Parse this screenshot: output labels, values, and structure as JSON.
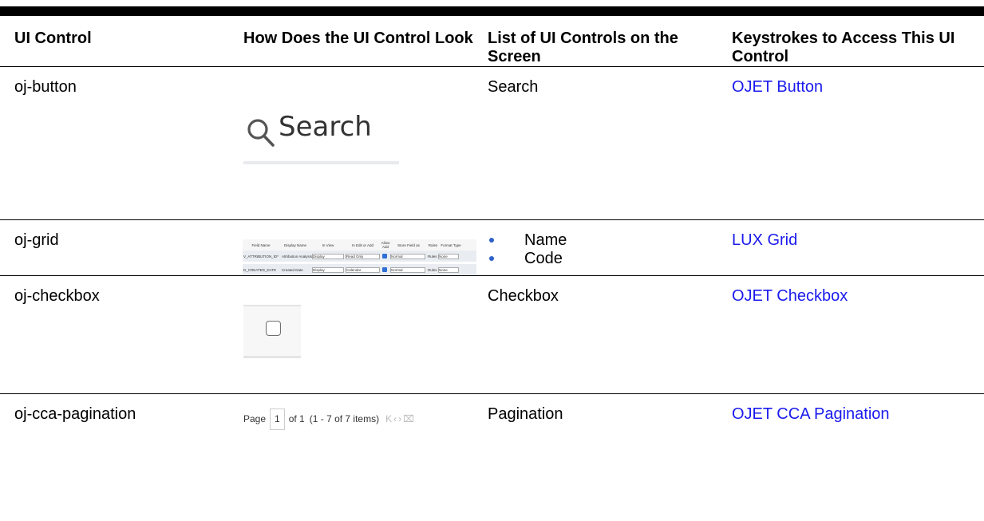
{
  "headers": {
    "col1": "UI Control",
    "col2": "How Does the UI Control Look",
    "col3": "List of UI Controls on the Screen",
    "col4": "Keystrokes to Access This UI Control"
  },
  "rows": [
    {
      "control": "oj-button",
      "controls_list": "Search",
      "link": "OJET Button",
      "image": {
        "search_text": "Search",
        "icon": "search-icon"
      }
    },
    {
      "control": "oj-grid",
      "controls_list": [
        "Name",
        "Code"
      ],
      "link": "LUX Grid",
      "image": {
        "headers": [
          "Field Name",
          "Display Name",
          "In View",
          "In Edit or Add",
          "Allow Add",
          "Store Field as",
          "Rules",
          "Format Type"
        ],
        "rows": [
          [
            "V_ATTRIBUTION_ID*",
            "Attribution Analysis",
            "Display",
            "Read Only",
            "",
            "Normal",
            "Rules",
            "None"
          ],
          [
            "D_CREATED_DATE",
            "Created Date",
            "Display",
            "Calendar",
            "",
            "Normal",
            "Rules",
            "None"
          ]
        ]
      }
    },
    {
      "control": "oj-checkbox",
      "controls_list": "Checkbox",
      "link": "OJET Checkbox"
    },
    {
      "control": "oj-cca-pagination",
      "controls_list": "Pagination",
      "link": "OJET CCA Pagination",
      "image": {
        "page_label": "Page",
        "page_value": "1",
        "of_text": "of 1",
        "range_text": "(1 - 7 of  7  items)"
      }
    }
  ]
}
